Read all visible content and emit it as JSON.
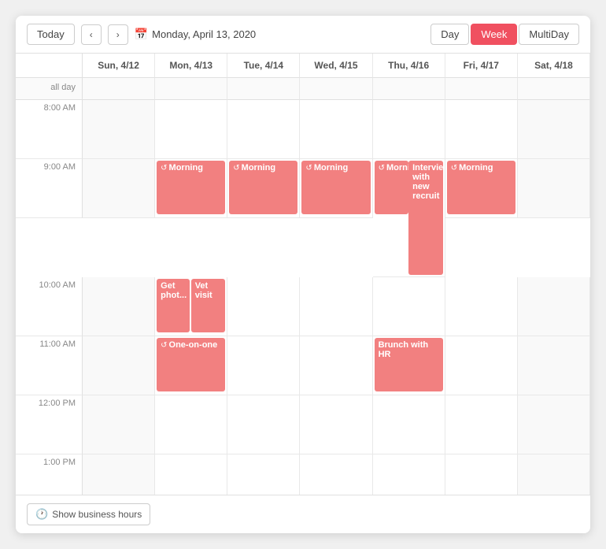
{
  "toolbar": {
    "today_label": "Today",
    "date_display": "Monday, April 13, 2020",
    "cal_icon": "📅",
    "prev_icon": "‹",
    "next_icon": "›",
    "views": [
      {
        "id": "day",
        "label": "Day",
        "active": false
      },
      {
        "id": "week",
        "label": "Week",
        "active": true
      },
      {
        "id": "multiday",
        "label": "MultiDay",
        "active": false
      }
    ]
  },
  "header": {
    "time_col_label": "",
    "days": [
      {
        "label": "Sun, 4/12"
      },
      {
        "label": "Mon, 4/13"
      },
      {
        "label": "Tue, 4/14"
      },
      {
        "label": "Wed, 4/15"
      },
      {
        "label": "Thu, 4/16"
      },
      {
        "label": "Fri, 4/17"
      },
      {
        "label": "Sat, 4/18"
      }
    ]
  },
  "allday": {
    "label": "all day"
  },
  "time_slots": [
    {
      "label": "8:00 AM"
    },
    {
      "label": "9:00 AM"
    },
    {
      "label": "10:00 AM"
    },
    {
      "label": "11:00 AM"
    },
    {
      "label": "12:00 PM"
    },
    {
      "label": "1:00 PM"
    }
  ],
  "events": {
    "morning_mon": {
      "title": "Morning",
      "recur": true,
      "slot": 1,
      "col": 1
    },
    "morning_tue": {
      "title": "Morning",
      "recur": true,
      "slot": 1,
      "col": 2
    },
    "morning_wed": {
      "title": "Morning",
      "recur": true,
      "slot": 1,
      "col": 3
    },
    "morning_thu": {
      "title": "Morning",
      "recur": true,
      "slot": 1,
      "col": 4
    },
    "morning_fri": {
      "title": "Morning",
      "recur": true,
      "slot": 1,
      "col": 5
    },
    "interview_thu": {
      "title": "Interview with new recruit",
      "slot": 1,
      "col": 4,
      "tall": true
    },
    "get_photo_mon": {
      "title": "Get phot...",
      "slot": 2,
      "col": 1,
      "half": "left"
    },
    "vet_visit_mon": {
      "title": "Vet visit",
      "slot": 2,
      "col": 1,
      "half": "right"
    },
    "brunch_thu": {
      "title": "Brunch with HR",
      "slot": 3,
      "col": 4
    },
    "one_on_one_mon": {
      "title": "One-on-one",
      "recur": true,
      "slot": 3,
      "col": 1
    }
  },
  "footer": {
    "show_hours_label": "Show business hours",
    "clock_icon": "🕐"
  }
}
